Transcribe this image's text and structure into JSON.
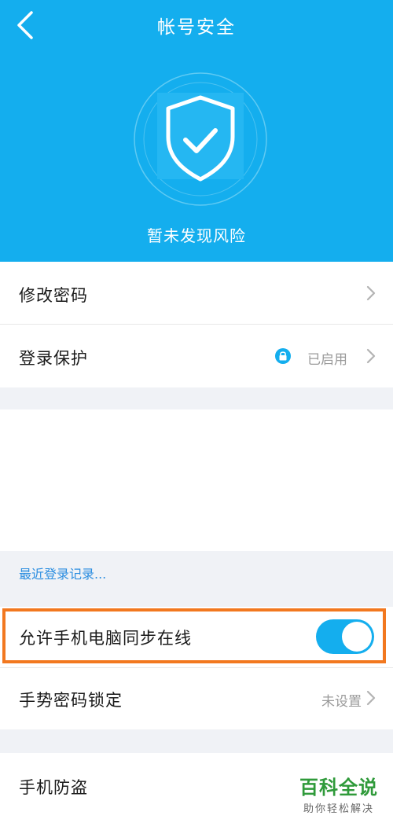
{
  "header": {
    "title": "帐号安全",
    "status": "暂未发现风险",
    "back_icon": "chevron-left-icon",
    "shield_icon": "shield-check-icon",
    "background_color": "#14aeee"
  },
  "rows": {
    "change_password": {
      "label": "修改密码",
      "icon": "chevron-right-icon"
    },
    "login_protect": {
      "label": "登录保护",
      "value": "已启用",
      "status_icon": "lock-icon",
      "icon": "chevron-right-icon"
    },
    "recent_login": {
      "label": "最近登录记录..."
    },
    "sync_online": {
      "label": "允许手机电脑同步在线",
      "toggle_on": true,
      "highlight_color": "#f2781f"
    },
    "gesture_lock": {
      "label": "手势密码锁定",
      "value": "未设置",
      "icon": "chevron-right-icon"
    },
    "anti_theft": {
      "label": "手机防盗"
    }
  },
  "watermark": {
    "title": "百科全说",
    "subtitle": "助你轻松解决"
  },
  "colors": {
    "accent": "#14aeee",
    "link": "#2c8ee0",
    "highlight": "#f2781f",
    "watermark": "#2f9a3a"
  }
}
